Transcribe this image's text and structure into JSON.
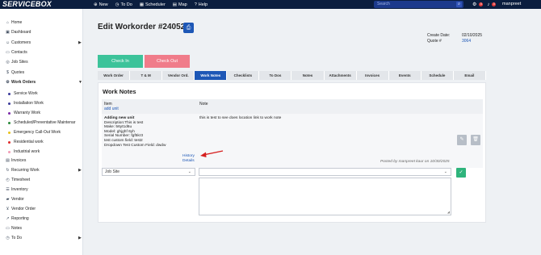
{
  "topbar": {
    "logo": "SERVICEBOX",
    "nav": [
      "New",
      "To Do",
      "Scheduler",
      "Map",
      "Help"
    ],
    "search_placeholder": "Search",
    "notif_count_1": "0",
    "notif_count_2": "0",
    "username": "manpreet"
  },
  "sidebar": {
    "items": [
      {
        "label": "Home",
        "icon": "home-icon"
      },
      {
        "label": "Dashboard",
        "icon": "dashboard-icon"
      },
      {
        "label": "Customers",
        "icon": "customers-icon"
      },
      {
        "label": "Contacts",
        "icon": "contacts-icon"
      },
      {
        "label": "Job Sites",
        "icon": "map-pin-icon"
      },
      {
        "label": "Quotes",
        "icon": "dollar-icon"
      },
      {
        "label": "Work Orders",
        "icon": "gear-icon"
      },
      {
        "label": "Service Work",
        "dot": "#3a3a9a"
      },
      {
        "label": "Installation Work",
        "dot": "#3a3a9a"
      },
      {
        "label": "Warranty Work",
        "dot": "#7b2aa8"
      },
      {
        "label": "Scheduled/Preventative Maintenar",
        "dot": "#2a8a3a"
      },
      {
        "label": "Emergency Call-Out Work",
        "dot": "#e8c21a"
      },
      {
        "label": "Residential work",
        "dot": "#e02a2a"
      },
      {
        "label": "Industrial work",
        "dot": "#f29bb5"
      },
      {
        "label": "Invoices",
        "icon": "invoice-icon"
      },
      {
        "label": "Recurring Work",
        "icon": "recurring-icon"
      },
      {
        "label": "Timesheet",
        "icon": "timesheet-icon"
      },
      {
        "label": "Inventory",
        "icon": "inventory-icon"
      },
      {
        "label": "Vendor",
        "icon": "truck-icon"
      },
      {
        "label": "Vendor Order",
        "icon": "cart-icon"
      },
      {
        "label": "Reporting",
        "icon": "chart-icon"
      },
      {
        "label": "Notes",
        "icon": "notes-icon"
      },
      {
        "label": "To Do",
        "icon": "clock-icon"
      }
    ]
  },
  "header": {
    "title": "Edit Workorder #240525",
    "create_date_label": "Create Date:",
    "create_date": "02/10/2025",
    "quote_label": "Quote #",
    "quote_value": "3064"
  },
  "actions": {
    "check_in": "Check In",
    "check_out": "Check Out"
  },
  "tabs": [
    "Work Order",
    "T & M",
    "Vendor Ord.",
    "Work Notes",
    "Checklists",
    "To Dos",
    "Notes",
    "Attachments",
    "Invoices",
    "Events",
    "Schedule",
    "Email"
  ],
  "active_tab": "Work Notes",
  "notes": {
    "title": "Work Notes",
    "col_item": "Item",
    "add_unit": "add unit",
    "col_note": "Note",
    "row": {
      "heading": "Adding new unit",
      "description": "Description:This is test",
      "make": "Make: 56yt1d6u",
      "model": "Model: ghjghf 6yh",
      "serial": "Serial Number: fgf5kr3",
      "custom": "test custom field: test2",
      "dropdown": "Dropdown Test Custom Field: dwdw",
      "note": "this is test to see does location link to work note",
      "history": "History",
      "details": "Details",
      "posted": "Posted by manpreet kaur on 10/30/2025"
    },
    "form": {
      "location_select": "Job Site",
      "note_select": "",
      "note_text": ""
    }
  },
  "colors": {
    "brand": "#0b1e3f",
    "accent": "#1d57b6",
    "check_in": "#3cc39a",
    "check_out": "#f07c8a",
    "arrow": "#d62020"
  }
}
